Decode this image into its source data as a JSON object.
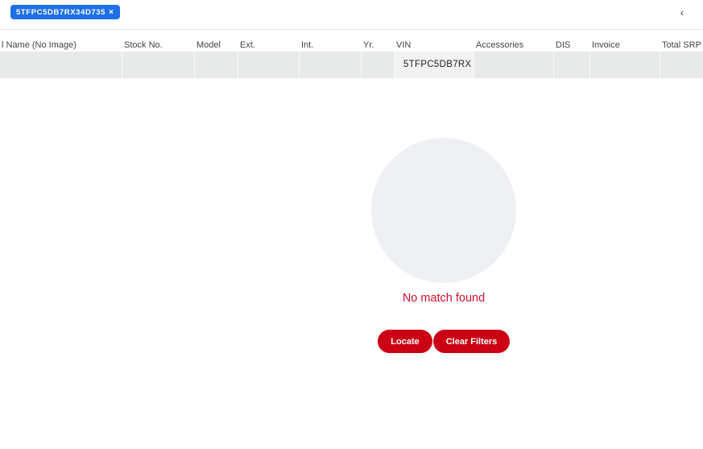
{
  "filter_chip": {
    "label": "5TFPC5DB7RX34D735",
    "close_glyph": "×"
  },
  "collapse_button": {
    "glyph": "‹"
  },
  "table": {
    "columns": [
      "l Name (No Image)",
      "Stock No.",
      "Model",
      "Ext.",
      "Int.",
      "Yr.",
      "VIN",
      "Accessories",
      "DIS",
      "Invoice",
      "Total SRP"
    ],
    "row": [
      "",
      "",
      "",
      "",
      "",
      "",
      "5TFPC5DB7RX",
      "",
      "",
      "",
      ""
    ]
  },
  "empty_state": {
    "message": "No match found",
    "locate_label": "Locate",
    "clear_filters_label": "Clear Filters"
  },
  "colors": {
    "chip_bg": "#1f6fe5",
    "accent_red": "#cc0015",
    "message_red": "#c8102e",
    "row_bg": "#e8e9e9",
    "circle_bg": "#eff0f3"
  }
}
